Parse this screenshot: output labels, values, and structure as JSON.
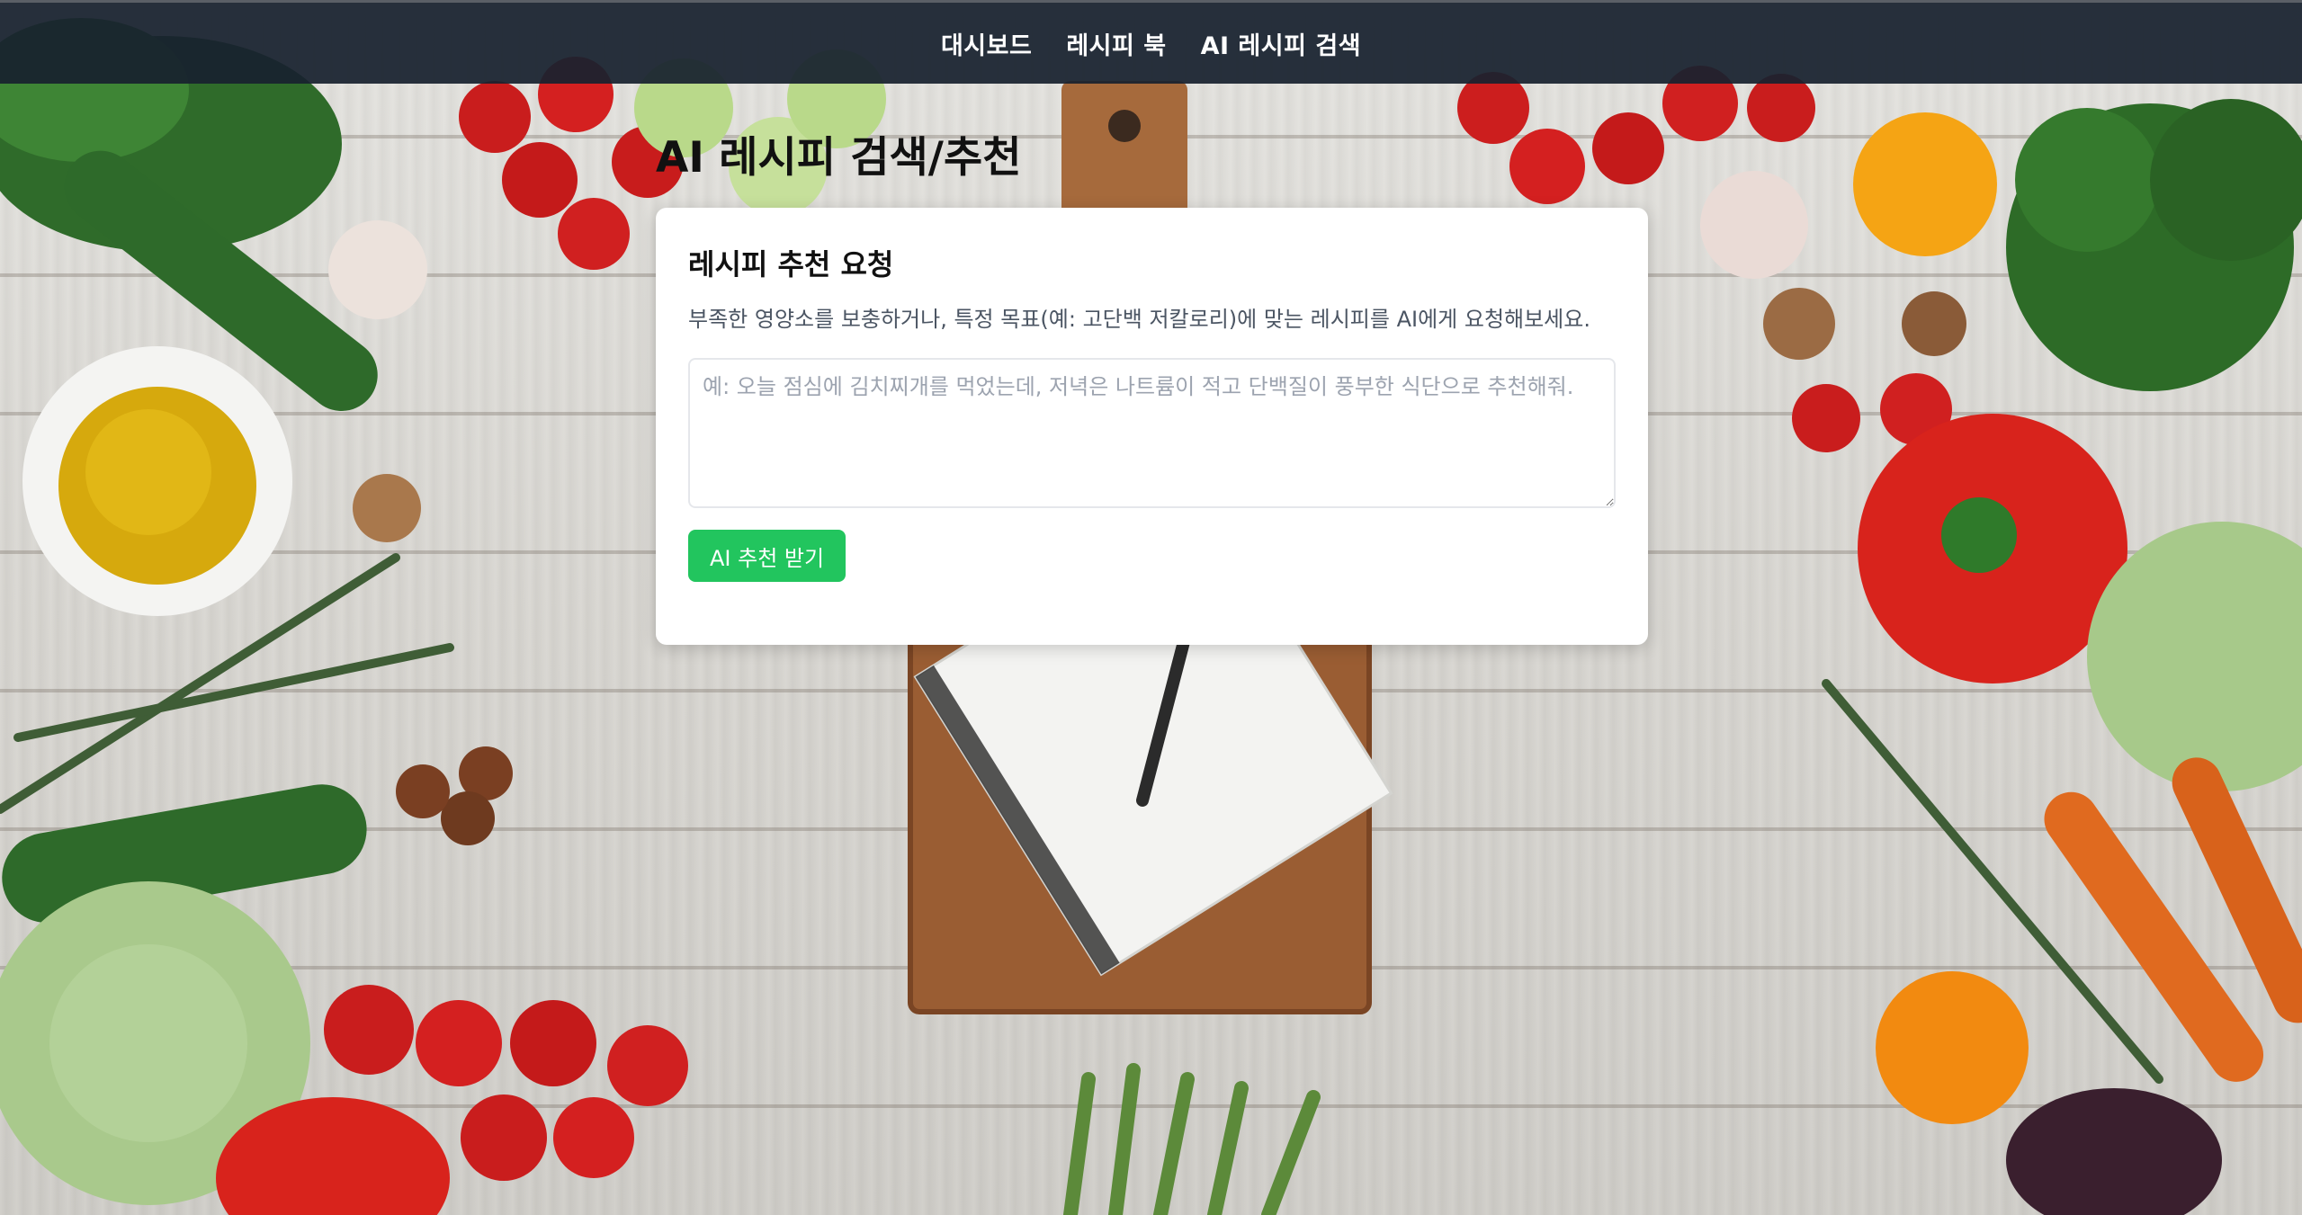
{
  "nav": {
    "items": [
      {
        "label": "대시보드"
      },
      {
        "label": "레시피 북"
      },
      {
        "label": "AI 레시피 검색"
      }
    ]
  },
  "page": {
    "title": "AI 레시피 검색/추천"
  },
  "request_card": {
    "title": "레시피 추천 요청",
    "description": "부족한 영양소를 보충하거나, 특정 목표(예: 고단백 저칼로리)에 맞는 레시피를 AI에게 요청해보세요.",
    "input_value": "",
    "input_placeholder": "예: 오늘 점심에 김치찌개를 먹었는데, 저녁은 나트륨이 적고 단백질이 풍부한 식단으로 추천해줘.",
    "submit_label": "AI 추천 받기"
  },
  "colors": {
    "navbar": "#18212e",
    "accent_button": "#22c55e",
    "card_background": "#ffffff",
    "description_text": "#4b5563"
  },
  "background": {
    "icon": "vegetables-table-photo"
  }
}
